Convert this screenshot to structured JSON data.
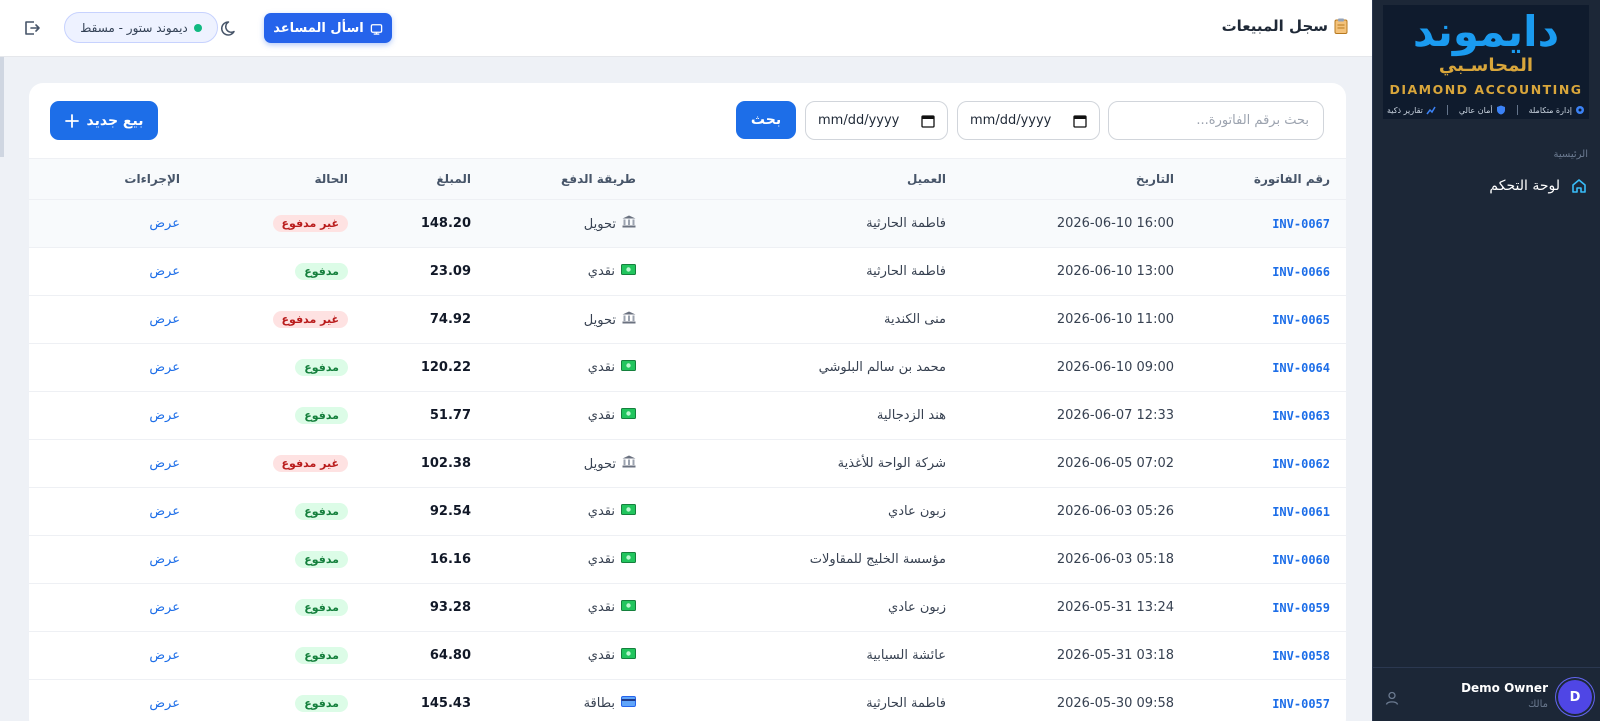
{
  "sidebar": {
    "logo": {
      "arabic": "دايموند",
      "subtitle": "المحاسـبي",
      "english": "DIAMOND ACCOUNTING",
      "tags": [
        "إدارة متكاملة",
        "أمان عالي",
        "تقارير ذكية"
      ]
    },
    "section_label": "الرئيسية",
    "items": [
      {
        "label": "لوحة التحكم",
        "icon": "home-icon"
      }
    ],
    "user": {
      "initial": "D",
      "name": "Demo Owner",
      "role": "مالك"
    }
  },
  "topbar": {
    "title": "سجل المبيعات",
    "assistant_label": "اسأل المساعد",
    "store_label": "ديموند ستور - مسقط",
    "store_status_color": "#10b981"
  },
  "filters": {
    "search_placeholder": "بحث برقم الفاتورة...",
    "date_from": "mm/dd/yyyy",
    "date_to": "mm/dd/yyyy",
    "search_button": "بحث",
    "new_sale_button": "بيع جديد"
  },
  "table": {
    "headers": [
      "رقم الفاتورة",
      "التاريخ",
      "العميل",
      "طريقة الدفع",
      "المبلغ",
      "الحالة",
      "الإجراءات"
    ],
    "rows": [
      {
        "invoice": "INV-0067",
        "date": "2026-06-10 16:00",
        "customer": "فاطمة الحارثية",
        "payment": "تحويل",
        "payment_icon": "bank-icon",
        "amount": "148.20",
        "status": "غير مدفوع",
        "status_type": "unpaid",
        "action": "عرض"
      },
      {
        "invoice": "INV-0066",
        "date": "2026-06-10 13:00",
        "customer": "فاطمة الحارثية",
        "payment": "نقدي",
        "payment_icon": "cash-icon",
        "amount": "23.09",
        "status": "مدفوع",
        "status_type": "paid",
        "action": "عرض"
      },
      {
        "invoice": "INV-0065",
        "date": "2026-06-10 11:00",
        "customer": "منى الكندية",
        "payment": "تحويل",
        "payment_icon": "bank-icon",
        "amount": "74.92",
        "status": "غير مدفوع",
        "status_type": "unpaid",
        "action": "عرض"
      },
      {
        "invoice": "INV-0064",
        "date": "2026-06-10 09:00",
        "customer": "محمد بن سالم البلوشي",
        "payment": "نقدي",
        "payment_icon": "cash-icon",
        "amount": "120.22",
        "status": "مدفوع",
        "status_type": "paid",
        "action": "عرض"
      },
      {
        "invoice": "INV-0063",
        "date": "2026-06-07 12:33",
        "customer": "هند الزدجالية",
        "payment": "نقدي",
        "payment_icon": "cash-icon",
        "amount": "51.77",
        "status": "مدفوع",
        "status_type": "paid",
        "action": "عرض"
      },
      {
        "invoice": "INV-0062",
        "date": "2026-06-05 07:02",
        "customer": "شركة الواحة للأغذية",
        "payment": "تحويل",
        "payment_icon": "bank-icon",
        "amount": "102.38",
        "status": "غير مدفوع",
        "status_type": "unpaid",
        "action": "عرض"
      },
      {
        "invoice": "INV-0061",
        "date": "2026-06-03 05:26",
        "customer": "زبون عادي",
        "payment": "نقدي",
        "payment_icon": "cash-icon",
        "amount": "92.54",
        "status": "مدفوع",
        "status_type": "paid",
        "action": "عرض"
      },
      {
        "invoice": "INV-0060",
        "date": "2026-06-03 05:18",
        "customer": "مؤسسة الخليج للمقاولات",
        "payment": "نقدي",
        "payment_icon": "cash-icon",
        "amount": "16.16",
        "status": "مدفوع",
        "status_type": "paid",
        "action": "عرض"
      },
      {
        "invoice": "INV-0059",
        "date": "2026-05-31 13:24",
        "customer": "زبون عادي",
        "payment": "نقدي",
        "payment_icon": "cash-icon",
        "amount": "93.28",
        "status": "مدفوع",
        "status_type": "paid",
        "action": "عرض"
      },
      {
        "invoice": "INV-0058",
        "date": "2026-05-31 03:18",
        "customer": "عائشة السيابية",
        "payment": "نقدي",
        "payment_icon": "cash-icon",
        "amount": "64.80",
        "status": "مدفوع",
        "status_type": "paid",
        "action": "عرض"
      },
      {
        "invoice": "INV-0057",
        "date": "2026-05-30 09:58",
        "customer": "فاطمة الحارثية",
        "payment": "بطاقة",
        "payment_icon": "card-icon",
        "amount": "145.43",
        "status": "مدفوع",
        "status_type": "paid",
        "action": "عرض"
      }
    ]
  },
  "colors": {
    "accent": "#1d6ee8",
    "sidebar_bg": "#1c2737",
    "paid": "#15803d",
    "unpaid": "#b91c1c"
  }
}
